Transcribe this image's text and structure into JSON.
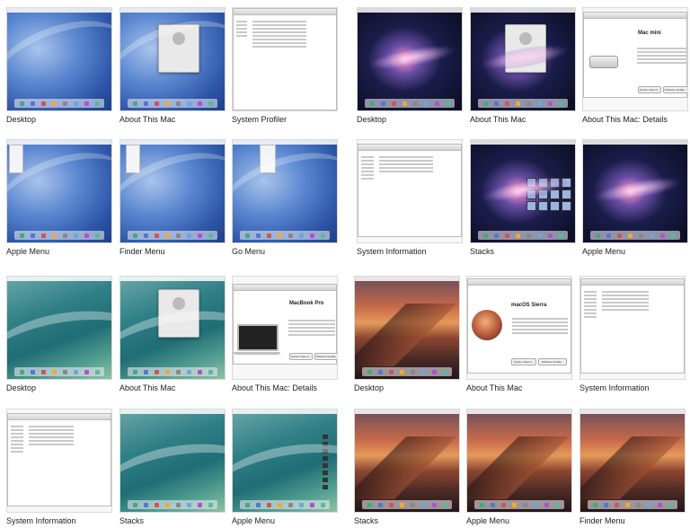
{
  "left_grid": {
    "rows": [
      [
        "Desktop",
        "About This Mac",
        "System Profiler"
      ],
      [
        "Apple Menu",
        "Finder Menu",
        "Go Menu"
      ],
      [
        "Desktop",
        "About This Mac",
        "About This Mac: Details"
      ],
      [
        "System Information",
        "Stacks",
        "Apple Menu"
      ]
    ]
  },
  "right_grid": {
    "rows": [
      [
        "Desktop",
        "About This Mac",
        "About This Mac: Details"
      ],
      [
        "System Information",
        "Stacks",
        "Apple Menu"
      ],
      [
        "Desktop",
        "About This Mac",
        "System Information"
      ],
      [
        "Stacks",
        "Apple Menu",
        "Finder Menu"
      ]
    ]
  },
  "thumb_text": {
    "macmini_title": "Mac mini",
    "macbook_title": "MacBook Pro",
    "sierra_title": "macOS Sierra",
    "system_report": "System Report...",
    "software_update": "Software Update..."
  }
}
